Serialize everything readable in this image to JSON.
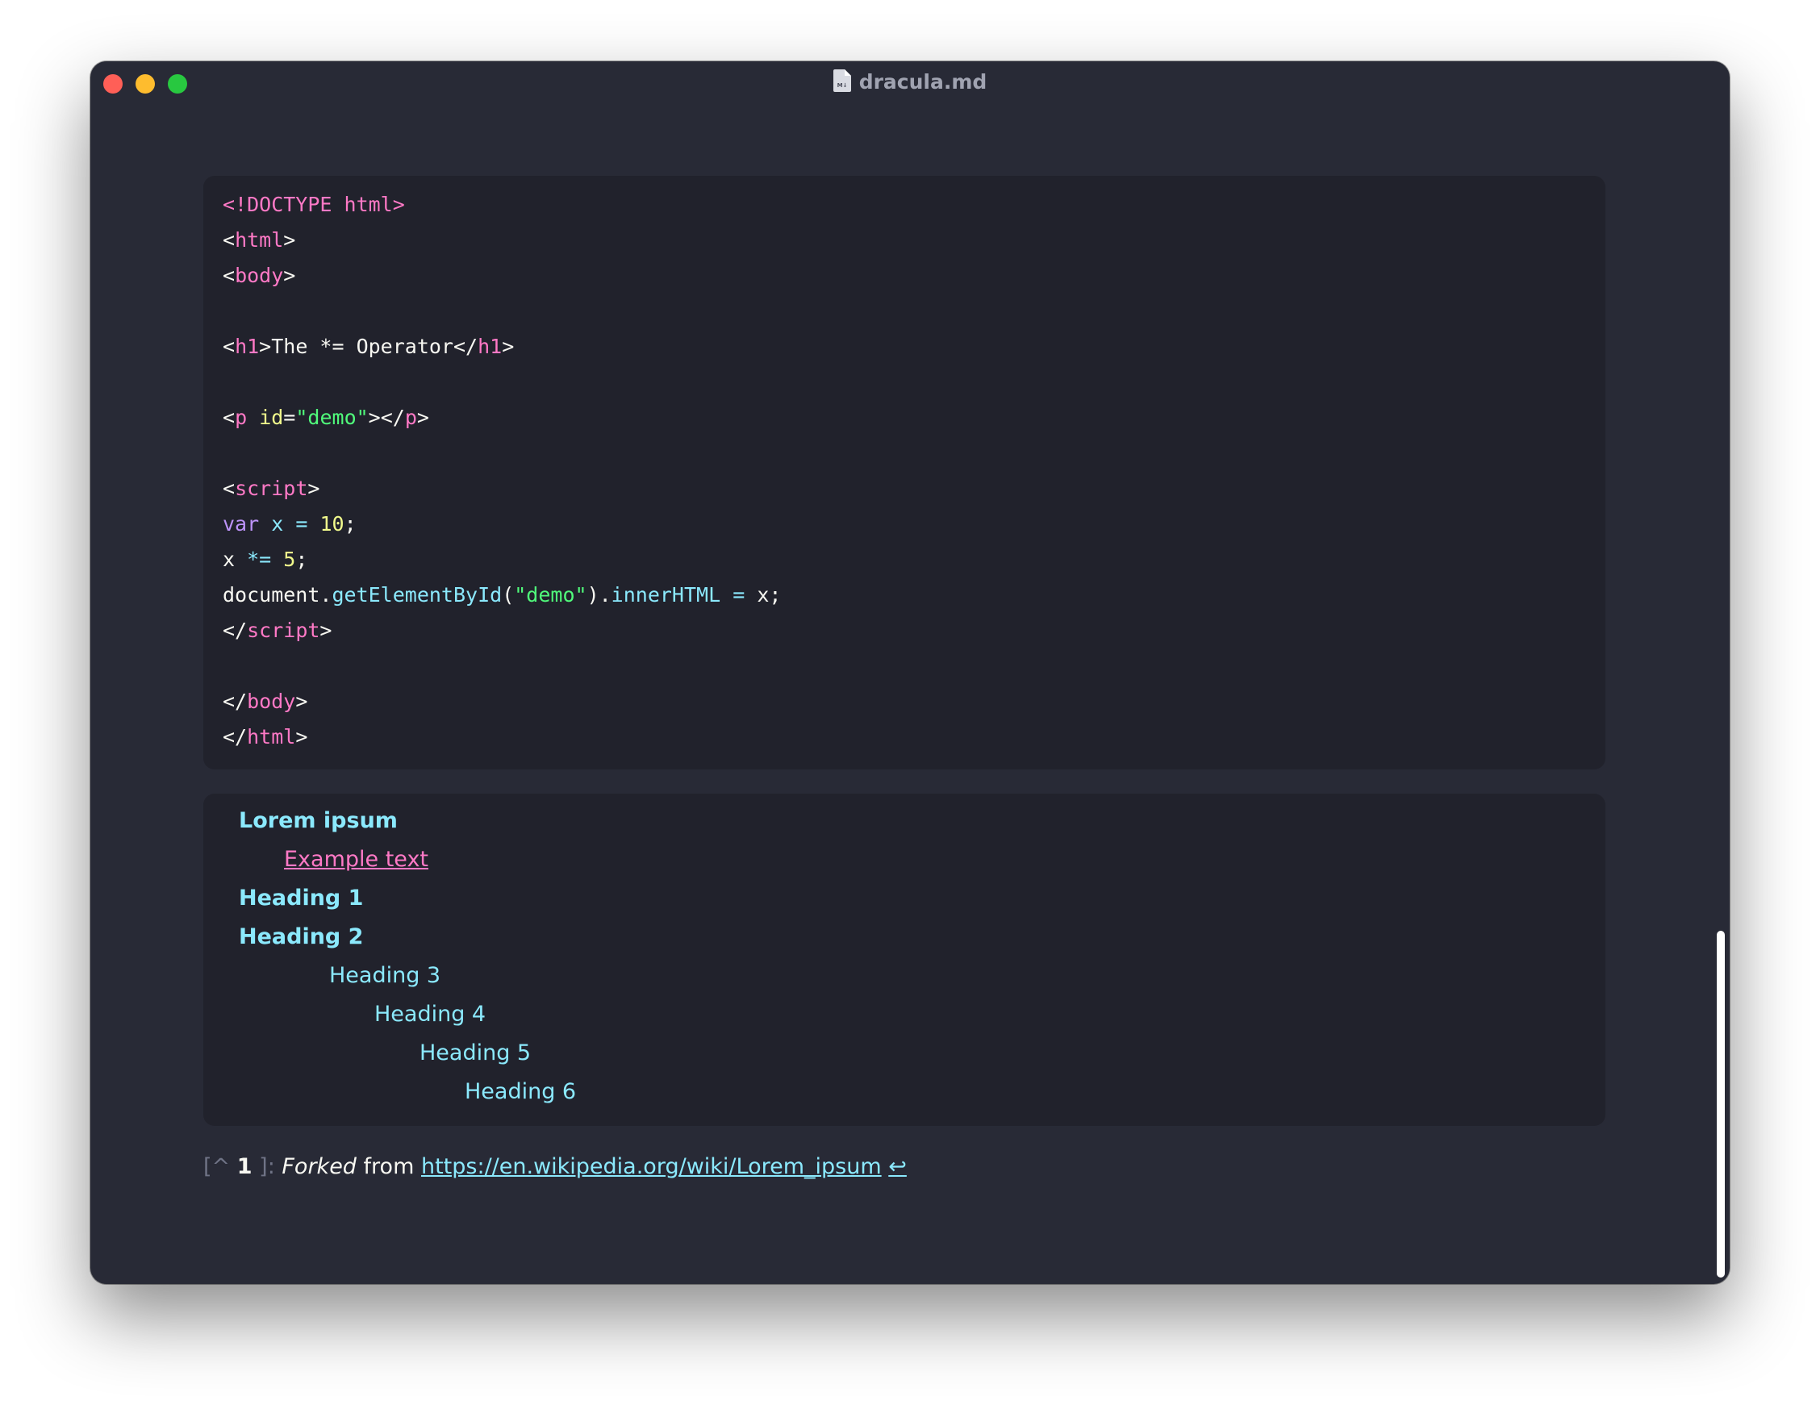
{
  "window": {
    "title": "dracula.md",
    "file_icon": "markdown-file-icon"
  },
  "code_lines": [
    [
      {
        "t": "<!DOCTYPE html>",
        "c": "pk"
      }
    ],
    [
      {
        "t": "<"
      },
      {
        "t": "html",
        "c": "pk"
      },
      {
        "t": ">"
      }
    ],
    [
      {
        "t": "<"
      },
      {
        "t": "body",
        "c": "pk"
      },
      {
        "t": ">"
      }
    ],
    [],
    [
      {
        "t": "<"
      },
      {
        "t": "h1",
        "c": "pk"
      },
      {
        "t": ">The *= Operator</"
      },
      {
        "t": "h1",
        "c": "pk"
      },
      {
        "t": ">"
      }
    ],
    [],
    [
      {
        "t": "<"
      },
      {
        "t": "p",
        "c": "pk"
      },
      {
        "t": " "
      },
      {
        "t": "id",
        "c": "attr"
      },
      {
        "t": "="
      },
      {
        "t": "\"demo\"",
        "c": "at"
      },
      {
        "t": "></"
      },
      {
        "t": "p",
        "c": "pk"
      },
      {
        "t": ">"
      }
    ],
    [],
    [
      {
        "t": "<"
      },
      {
        "t": "script",
        "c": "pk"
      },
      {
        "t": ">"
      }
    ],
    [
      {
        "t": "var",
        "c": "kw"
      },
      {
        "t": " "
      },
      {
        "t": "x",
        "c": "cy"
      },
      {
        "t": " "
      },
      {
        "t": "=",
        "c": "cy"
      },
      {
        "t": " "
      },
      {
        "t": "10",
        "c": "nm"
      },
      {
        "t": ";"
      }
    ],
    [
      {
        "t": "x "
      },
      {
        "t": "*=",
        "c": "cy"
      },
      {
        "t": " "
      },
      {
        "t": "5",
        "c": "nm"
      },
      {
        "t": ";"
      }
    ],
    [
      {
        "t": "document."
      },
      {
        "t": "getElementById",
        "c": "cy"
      },
      {
        "t": "("
      },
      {
        "t": "\"demo\"",
        "c": "at"
      },
      {
        "t": ")."
      },
      {
        "t": "innerHTML",
        "c": "cy"
      },
      {
        "t": " "
      },
      {
        "t": "=",
        "c": "cy"
      },
      {
        "t": " x;"
      }
    ],
    [
      {
        "t": "</"
      },
      {
        "t": "script",
        "c": "pk"
      },
      {
        "t": ">"
      }
    ],
    [],
    [
      {
        "t": "</"
      },
      {
        "t": "body",
        "c": "pk"
      },
      {
        "t": ">"
      }
    ],
    [
      {
        "t": "</"
      },
      {
        "t": "html",
        "c": "pk"
      },
      {
        "t": ">"
      }
    ]
  ],
  "toc": [
    {
      "text": "Lorem ipsum",
      "level": 1,
      "style": "bold"
    },
    {
      "text": "Example text",
      "level": 2,
      "style": "link"
    },
    {
      "text": "Heading 1",
      "level": 1,
      "style": "bold"
    },
    {
      "text": "Heading 2",
      "level": 1,
      "style": "bold"
    },
    {
      "text": "Heading 3",
      "level": 3,
      "style": "normal"
    },
    {
      "text": "Heading 4",
      "level": 4,
      "style": "normal"
    },
    {
      "text": "Heading 5",
      "level": 5,
      "style": "normal"
    },
    {
      "text": "Heading 6",
      "level": 6,
      "style": "normal"
    }
  ],
  "footnote": {
    "open": "[^",
    "number": "1",
    "close": "]",
    "colon": ":",
    "italic": "Forked",
    "text": "from",
    "link": "https://en.wikipedia.org/wiki/Lorem_ipsum",
    "backref": "↩"
  },
  "colors": {
    "background": "#282a36",
    "block": "#21222c",
    "pink": "#ff79c6",
    "green": "#50fa7b",
    "yellow": "#f1fa8c",
    "purple": "#bd93f9",
    "cyan": "#8be9fd",
    "foreground": "#f8f8f2"
  }
}
